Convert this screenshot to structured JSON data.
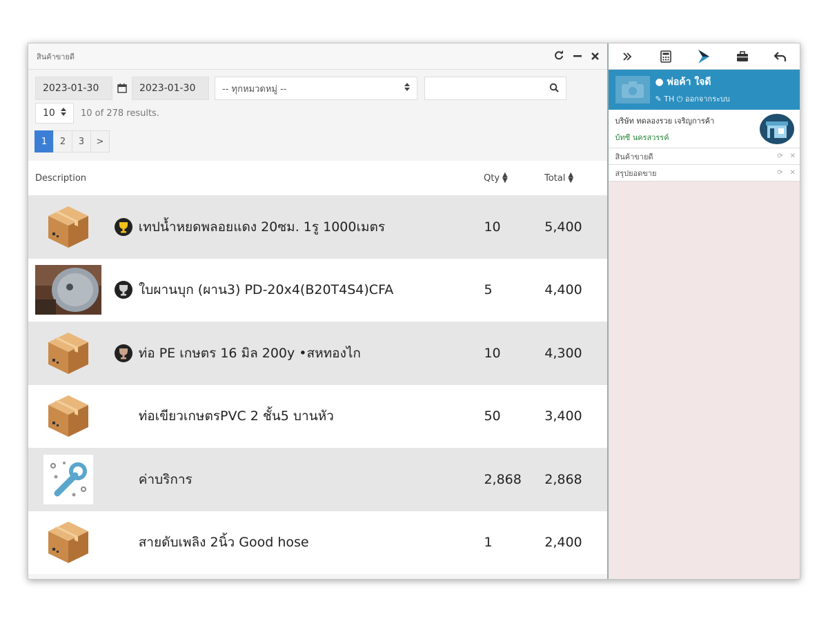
{
  "window": {
    "title": "สินค้าขายดี",
    "refresh_icon": "refresh-icon",
    "minimize_icon": "minimize-icon",
    "close_icon": "close-icon"
  },
  "filters": {
    "date_from": "2023-01-30",
    "date_to": "2023-01-30",
    "category_selected": "-- ทุกหมวดหมู่ --",
    "search_placeholder": "",
    "page_size": "10",
    "results_text": "10 of 278 results."
  },
  "pagination": {
    "pages": [
      "1",
      "2",
      "3"
    ],
    "next": ">",
    "active": "1"
  },
  "table": {
    "headers": {
      "description": "Description",
      "qty": "Qty",
      "total": "Total"
    },
    "rows": [
      {
        "thumb": "box",
        "badge": "gold",
        "description": "เทปน้ำหยดพลอยแดง 20ซม. 1รู 1000เมตร",
        "qty": "10",
        "total": "5,400"
      },
      {
        "thumb": "blade",
        "badge": "silver",
        "description": "ใบผานบุก (ผาน3) PD-20x4(B20T4S4)CFA",
        "qty": "5",
        "total": "4,400"
      },
      {
        "thumb": "box",
        "badge": "bronze",
        "description": "ท่อ PE เกษตร 16 มิล 200y •สหทองไก",
        "qty": "10",
        "total": "4,300"
      },
      {
        "thumb": "box",
        "badge": "",
        "description": "ท่อเขียวเกษตรPVC 2 ชั้น5 บานหัว",
        "qty": "50",
        "total": "3,400"
      },
      {
        "thumb": "service",
        "badge": "",
        "description": "ค่าบริการ",
        "qty": "2,868",
        "total": "2,868"
      },
      {
        "thumb": "box",
        "badge": "",
        "description": "สายดับเพลิง 2นิ้ว Good hose",
        "qty": "1",
        "total": "2,400"
      }
    ]
  },
  "sidebar": {
    "user_name": "พ่อค้า ใจดี",
    "lang": "TH",
    "logout": "ออกจากระบบ",
    "company": "บริษัท ทดลองรวย เจริญการค้า",
    "branch": "บ้ทซี นครสวรรค์",
    "widgets": [
      "สินค้าขายดี",
      "สรุปยอดขาย"
    ]
  },
  "colors": {
    "accent": "#2b8fc0",
    "pager_active": "#3a7fd5",
    "sidebar_bg": "#f3e6e6"
  }
}
